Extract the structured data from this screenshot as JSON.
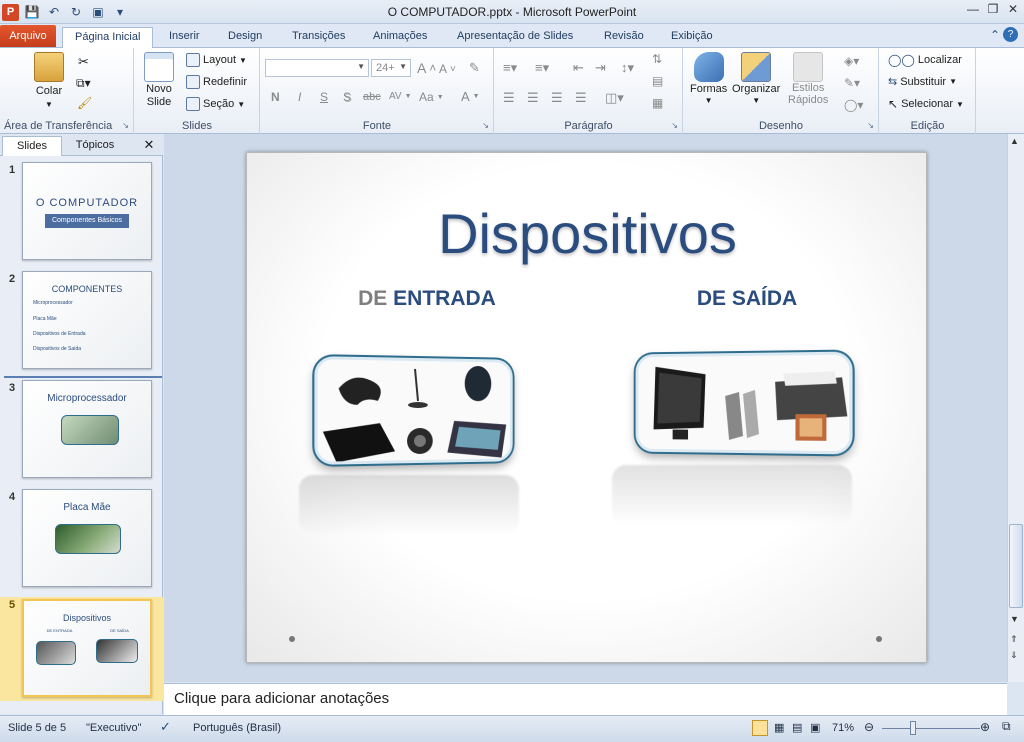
{
  "window": {
    "title": "O COMPUTADOR.pptx - Microsoft PowerPoint"
  },
  "tabs": {
    "file": "Arquivo",
    "items": [
      "Página Inicial",
      "Inserir",
      "Design",
      "Transições",
      "Animações",
      "Apresentação de Slides",
      "Revisão",
      "Exibição"
    ]
  },
  "ribbon": {
    "clipboard": {
      "paste": "Colar",
      "group": "Área de Transferência"
    },
    "slides": {
      "new_slide_1": "Novo",
      "new_slide_2": "Slide",
      "layout": "Layout",
      "reset": "Redefinir",
      "section": "Seção",
      "group": "Slides"
    },
    "font": {
      "size": "24+",
      "bold": "N",
      "italic": "I",
      "underline": "S",
      "shadow": "S",
      "strike": "abc",
      "spacing": "AV",
      "case": "Aa",
      "color": "A",
      "grow": "A",
      "shrink": "A",
      "group": "Fonte"
    },
    "paragraph": {
      "group": "Parágrafo"
    },
    "drawing": {
      "shapes": "Formas",
      "arrange": "Organizar",
      "quick_styles_1": "Estilos",
      "quick_styles_2": "Rápidos",
      "group": "Desenho"
    },
    "editing": {
      "find": "Localizar",
      "replace": "Substituir",
      "select": "Selecionar",
      "group": "Edição"
    }
  },
  "pane": {
    "tab_slides": "Slides",
    "tab_outline": "Tópicos",
    "thumbs": [
      {
        "num": "1",
        "title": "O COMPUTADOR",
        "subtitle": "Componentes Básicos"
      },
      {
        "num": "2",
        "title": "COMPONENTES",
        "bullets": [
          "Microprocessador",
          "Placa Mãe",
          "Dispositivos de Entrada",
          "Dispositivos de Saída"
        ]
      },
      {
        "num": "3",
        "title": "Microprocessador"
      },
      {
        "num": "4",
        "title": "Placa Mãe"
      },
      {
        "num": "5",
        "title": "Dispositivos",
        "left": "DE ENTRADA",
        "right": "DE SAÍDA"
      }
    ]
  },
  "slide": {
    "title": "Dispositivos",
    "left_prefix": "DE",
    "left_word": "ENTRADA",
    "right_label": "DE SAÍDA"
  },
  "notes": {
    "placeholder": "Clique para adicionar anotações"
  },
  "status": {
    "slide_info": "Slide 5 de 5",
    "theme": "\"Executivo\"",
    "language": "Português (Brasil)",
    "zoom": "71%"
  },
  "colors": {
    "accent": "#2b4c7e",
    "file_tab": "#d24726",
    "selected_thumb": "#fbe6a0"
  }
}
